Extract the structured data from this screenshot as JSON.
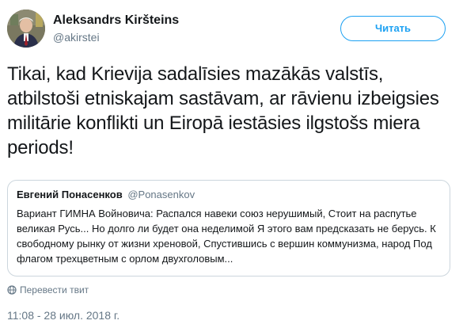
{
  "author": {
    "name": "Aleksandrs Kiršteins",
    "handle": "@akirstei"
  },
  "follow_button": {
    "label": "Читать"
  },
  "tweet": {
    "text": "Tikai, kad Krievija sadalīsies mazākās valstīs, atbilstoši etniskajam sastāvam, ar rāvienu izbeigsies militārie konflikti un Eiropā iestāsies ilgstošs miera periods!"
  },
  "quoted_tweet": {
    "name": "Евгений Понасенков",
    "handle": "@Ponasenkov",
    "text": "Вариант ГИМНА Войновича: Распался навеки союз нерушимый, Стоит на распутье великая Русь... Но долго ли будет она неделимой Я этого вам предсказать не берусь. К свободному рынку от жизни хреновой, Спустившись с вершин коммунизма, народ Под флагом трехцветным с орлом двухголовым..."
  },
  "translate": {
    "label": "Перевести твит",
    "icon": "globe-icon"
  },
  "timestamp": "11:08 - 28 июл. 2018 г.",
  "colors": {
    "accent": "#1da1f2",
    "secondary_text": "#657786",
    "border": "#ccd6dd"
  }
}
